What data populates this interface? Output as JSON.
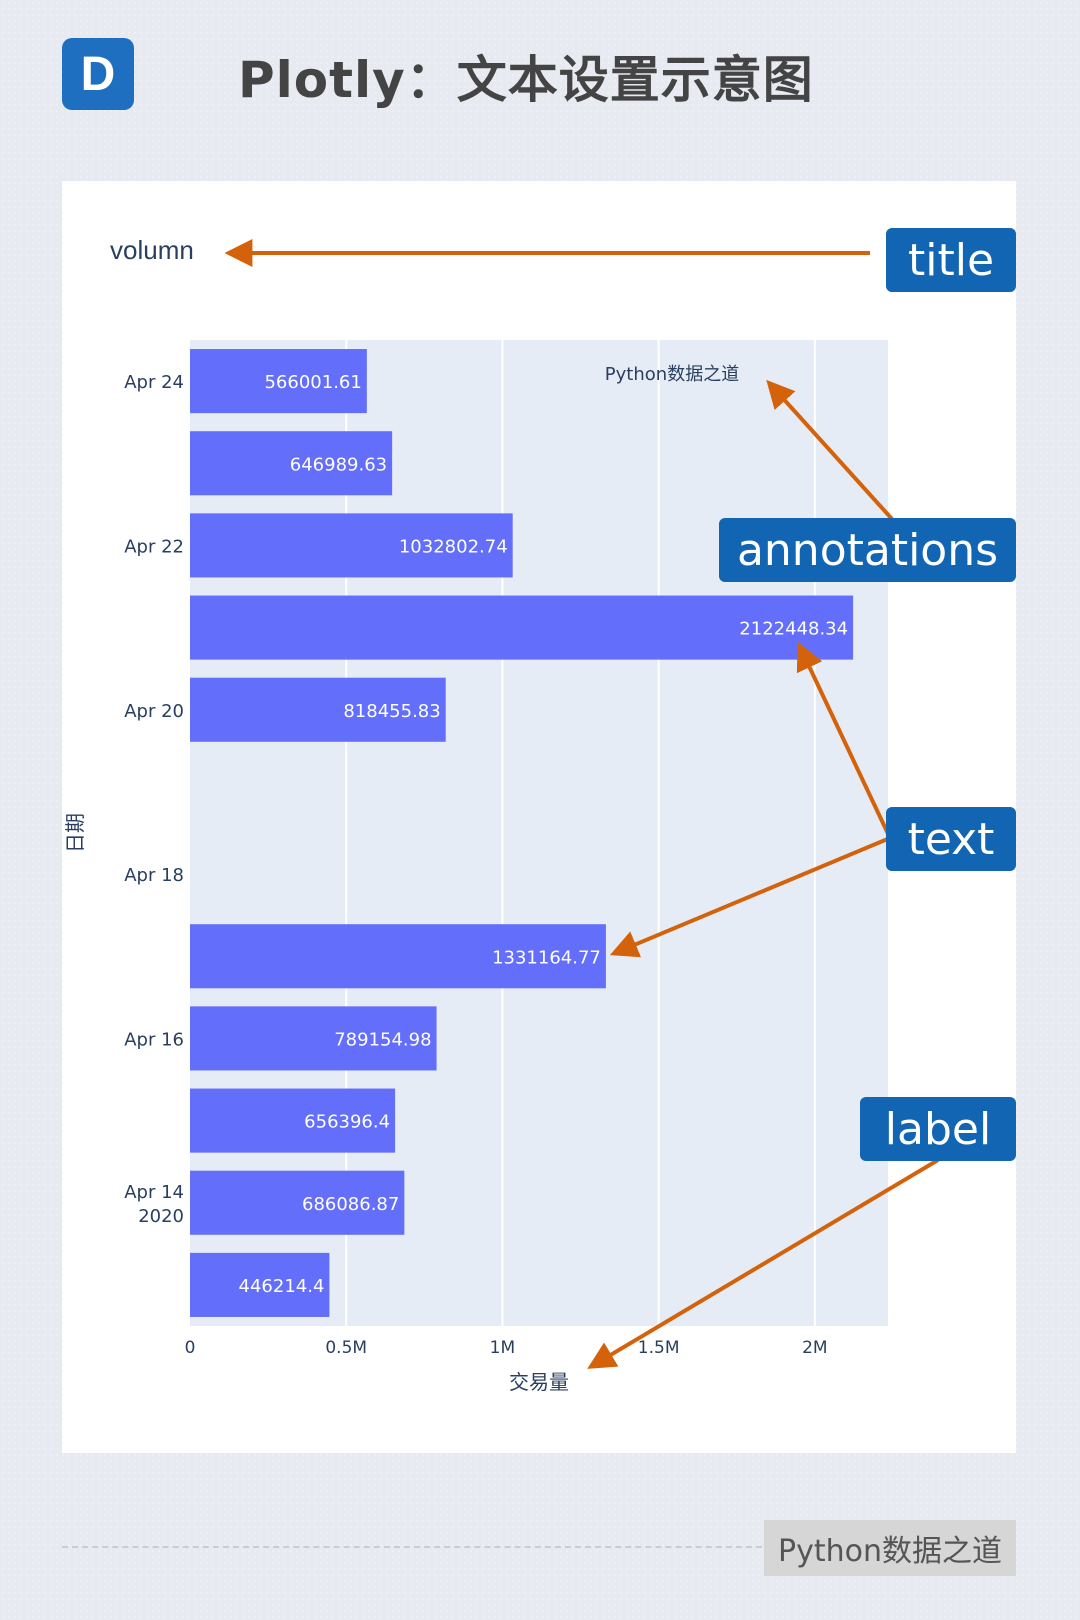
{
  "header": {
    "badge": "D",
    "title": "Plotly：文本设置示意图"
  },
  "callouts": {
    "title": "title",
    "annotations": "annotations",
    "text": "text",
    "label": "label"
  },
  "footer": {
    "tag": "Python数据之道"
  },
  "colors": {
    "bar": "#636efa",
    "plot_bg": "#e5ecf6",
    "arrow": "#d4620a",
    "callout_bg": "#1165b3"
  },
  "chart_data": {
    "type": "bar",
    "orientation": "horizontal",
    "title": "volumn",
    "xlabel": "交易量",
    "ylabel": "日期",
    "annotation": "Python数据之道",
    "xlim": [
      0,
      2234156
    ],
    "x_ticks": [
      {
        "value": 0,
        "label": "0"
      },
      {
        "value": 500000,
        "label": "0.5M"
      },
      {
        "value": 1000000,
        "label": "1M"
      },
      {
        "value": 1500000,
        "label": "1.5M"
      },
      {
        "value": 2000000,
        "label": "2M"
      }
    ],
    "y_ticks": [
      {
        "date": "2020-04-24",
        "label": [
          "Apr 24"
        ]
      },
      {
        "date": "2020-04-22",
        "label": [
          "Apr 22"
        ]
      },
      {
        "date": "2020-04-20",
        "label": [
          "Apr 20"
        ]
      },
      {
        "date": "2020-04-18",
        "label": [
          "Apr 18"
        ]
      },
      {
        "date": "2020-04-16",
        "label": [
          "Apr 16"
        ]
      },
      {
        "date": "2020-04-14",
        "label": [
          "Apr 14",
          "2020"
        ]
      }
    ],
    "bars": [
      {
        "date": "2020-04-24",
        "value": 566001.61,
        "text": "566001.61"
      },
      {
        "date": "2020-04-23",
        "value": 646989.63,
        "text": "646989.63"
      },
      {
        "date": "2020-04-22",
        "value": 1032802.74,
        "text": "1032802.74"
      },
      {
        "date": "2020-04-21",
        "value": 2122448.34,
        "text": "2122448.34"
      },
      {
        "date": "2020-04-20",
        "value": 818455.83,
        "text": "818455.83"
      },
      {
        "date": "2020-04-17",
        "value": 1331164.77,
        "text": "1331164.77"
      },
      {
        "date": "2020-04-16",
        "value": 789154.98,
        "text": "789154.98"
      },
      {
        "date": "2020-04-15",
        "value": 656396.4,
        "text": "656396.4"
      },
      {
        "date": "2020-04-14",
        "value": 686086.87,
        "text": "686086.87"
      },
      {
        "date": "2020-04-13",
        "value": 446214.4,
        "text": "446214.4"
      }
    ]
  }
}
